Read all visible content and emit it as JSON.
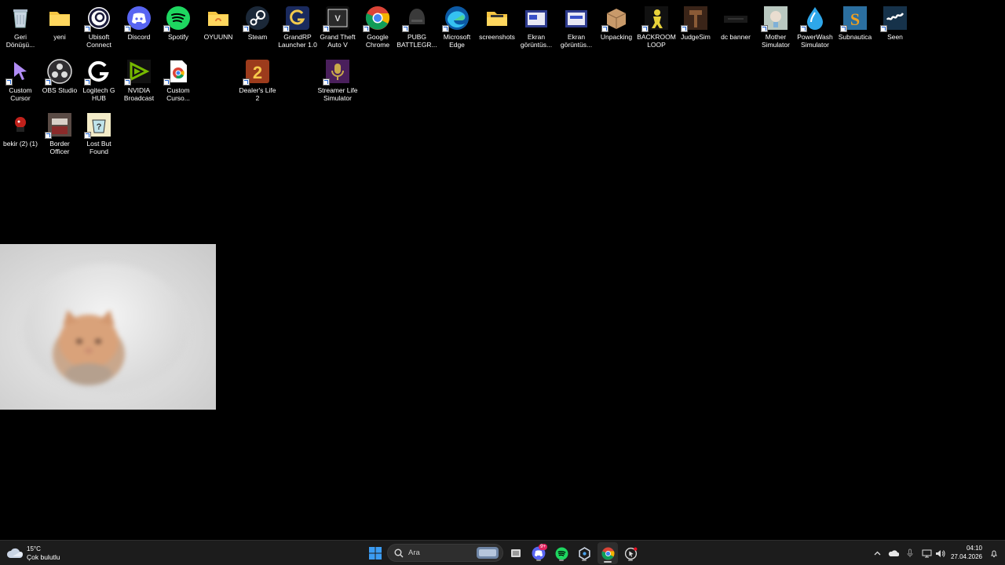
{
  "desktop": {
    "icons": [
      {
        "id": "recycle-bin",
        "label": "Geri Dönüşü...",
        "icon": "recycle-bin-icon",
        "shortcut": false
      },
      {
        "id": "folder-yeni",
        "label": "yeni",
        "icon": "folder-icon",
        "shortcut": false
      },
      {
        "id": "ubisoft-connect",
        "label": "Ubisoft Connect",
        "icon": "ubisoft-icon",
        "shortcut": true
      },
      {
        "id": "discord",
        "label": "Discord",
        "icon": "discord-icon",
        "shortcut": true
      },
      {
        "id": "spotify",
        "label": "Spotify",
        "icon": "spotify-icon",
        "shortcut": true
      },
      {
        "id": "folder-oyuunn",
        "label": "OYUUNN",
        "icon": "folder-icon",
        "shortcut": false
      },
      {
        "id": "steam",
        "label": "Steam",
        "icon": "steam-icon",
        "shortcut": true
      },
      {
        "id": "grandrp-launcher",
        "label": "GrandRP Launcher 1.0",
        "icon": "grandrp-icon",
        "shortcut": true
      },
      {
        "id": "gta-v",
        "label": "Grand Theft Auto V",
        "icon": "gta-icon",
        "shortcut": true
      },
      {
        "id": "google-chrome",
        "label": "Google Chrome",
        "icon": "chrome-icon",
        "shortcut": true
      },
      {
        "id": "pubg",
        "label": "PUBG BATTLEGR...",
        "icon": "pubg-icon",
        "shortcut": true
      },
      {
        "id": "microsoft-edge",
        "label": "Microsoft Edge",
        "icon": "edge-icon",
        "shortcut": true
      },
      {
        "id": "folder-screenshots",
        "label": "screenshots",
        "icon": "folder-icon",
        "shortcut": false
      },
      {
        "id": "ekran-goruntusu-1",
        "label": "Ekran görüntüs...",
        "icon": "screenshot-file-icon",
        "shortcut": false
      },
      {
        "id": "ekran-goruntusu-2",
        "label": "Ekran görüntüs...",
        "icon": "screenshot-file-icon",
        "shortcut": false
      },
      {
        "id": "unpacking",
        "label": "Unpacking",
        "icon": "unpacking-icon",
        "shortcut": true
      },
      {
        "id": "backroom-loop",
        "label": "BACKROOM LOOP",
        "icon": "backroom-loop-icon",
        "shortcut": true
      },
      {
        "id": "judgesim",
        "label": "JudgeSim",
        "icon": "judgesim-icon",
        "shortcut": true
      },
      {
        "id": "dc-banner",
        "label": "dc banner",
        "icon": "image-file-icon",
        "shortcut": false
      },
      {
        "id": "mother-simulator",
        "label": "Mother Simulator",
        "icon": "mother-simulator-icon",
        "shortcut": true
      },
      {
        "id": "powerwash-simulator",
        "label": "PowerWash Simulator",
        "icon": "powerwash-icon",
        "shortcut": true
      },
      {
        "id": "subnautica",
        "label": "Subnautica",
        "icon": "subnautica-icon",
        "shortcut": true
      },
      {
        "id": "seen",
        "label": "Seen",
        "icon": "seen-icon",
        "shortcut": true
      },
      {
        "id": "custom-cursor",
        "label": "Custom Cursor",
        "icon": "custom-cursor-icon",
        "shortcut": true
      },
      {
        "id": "obs-studio",
        "label": "OBS Studio",
        "icon": "obs-icon",
        "shortcut": true
      },
      {
        "id": "logitech-g-hub",
        "label": "Logitech G HUB",
        "icon": "logitech-icon",
        "shortcut": true
      },
      {
        "id": "nvidia-broadcast",
        "label": "NVIDIA Broadcast",
        "icon": "nvidia-icon",
        "shortcut": true
      },
      {
        "id": "custom-cursor-chrome",
        "label": "Custom Curso...",
        "icon": "chrome-file-icon",
        "shortcut": true
      },
      {
        "id": "dealers-life-2",
        "label": "Dealer's Life 2",
        "icon": "dealers-life-icon",
        "shortcut": true
      },
      {
        "id": "streamer-life-simulator",
        "label": "Streamer Life Simulator",
        "icon": "streamer-life-icon",
        "shortcut": true
      },
      {
        "id": "bekir",
        "label": "bekir (2) (1)",
        "icon": "bekir-icon",
        "shortcut": false
      },
      {
        "id": "border-officer",
        "label": "Border Officer",
        "icon": "border-officer-icon",
        "shortcut": true
      },
      {
        "id": "lost-but-found",
        "label": "Lost But Found",
        "icon": "lost-but-found-icon",
        "shortcut": true
      }
    ]
  },
  "taskbar": {
    "weather": {
      "temp": "15°C",
      "desc": "Çok bulutlu",
      "icon": "weather-cloudy-icon"
    },
    "search": {
      "placeholder": "Ara"
    },
    "discord_badge": "9+",
    "clock": {
      "time": "04:10",
      "date": "27.04.2026"
    },
    "apps": [
      "start-icon",
      "search-icon",
      "task-view-icon",
      "discord-icon",
      "spotify-icon",
      "logitech-icon",
      "chrome-icon",
      "custom-cursor-icon"
    ],
    "tray": [
      "chevron-up-icon",
      "onedrive-icon",
      "microphone-icon",
      "network-icon",
      "volume-icon",
      "notification-icon"
    ]
  },
  "colors": {
    "desktop_bg": "#000000",
    "taskbar_bg": "#1c1c1c",
    "accent": "#0078d4"
  }
}
